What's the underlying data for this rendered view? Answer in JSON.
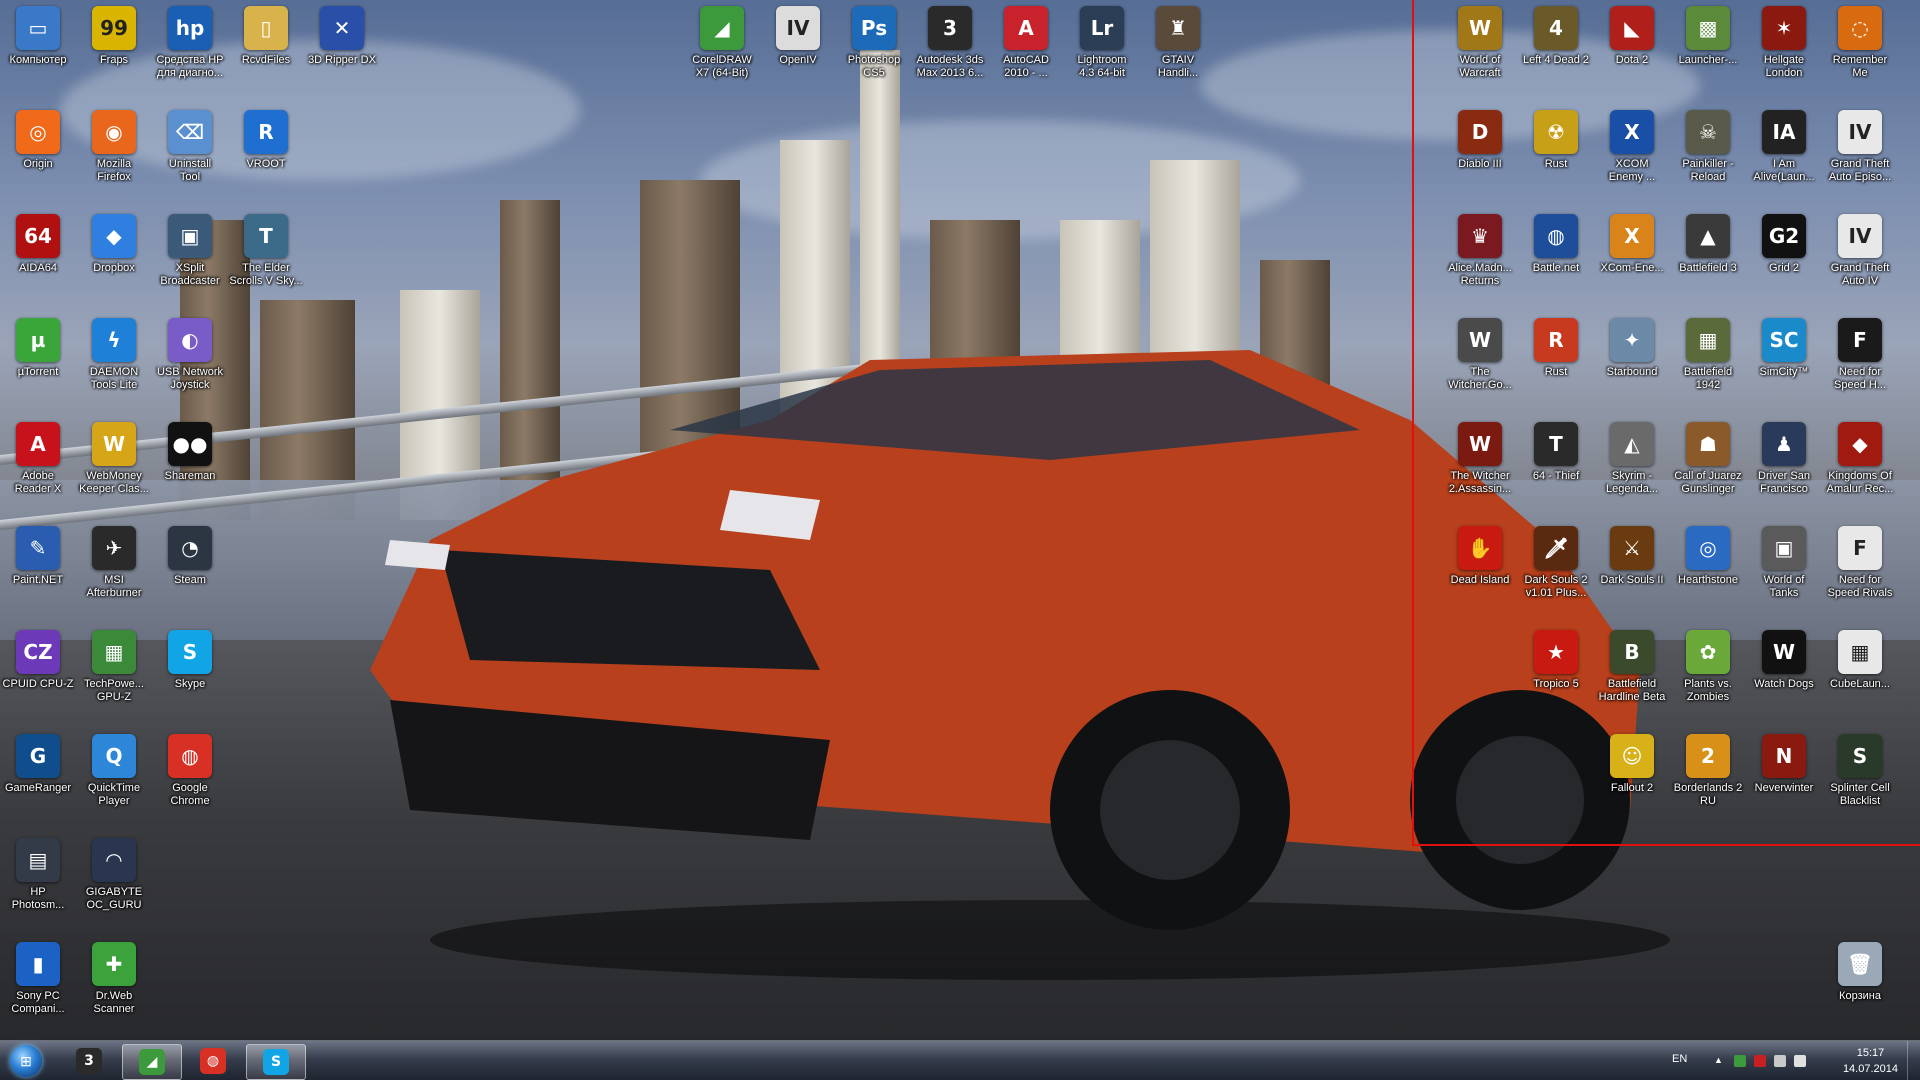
{
  "desktop": {
    "left_icons": [
      {
        "label": "Компьютер",
        "glyph": "▭",
        "color": "#3a78c8"
      },
      {
        "label": "Fraps",
        "glyph": "99",
        "color": "#d9b400"
      },
      {
        "label": "Средства HP\nдля диагно...",
        "glyph": "hp",
        "color": "#1a5fb4"
      },
      {
        "label": "RcvdFiles",
        "glyph": "▯",
        "color": "#d8b24a"
      },
      {
        "label": "3D Ripper DX",
        "glyph": "✕",
        "color": "#2a4fa8"
      },
      {
        "label": "Origin",
        "glyph": "◎",
        "color": "#f06a1a"
      },
      {
        "label": "Mozilla\nFirefox",
        "glyph": "◉",
        "color": "#e8671c"
      },
      {
        "label": "Uninstall\nTool",
        "glyph": "⌫",
        "color": "#5a8fd0"
      },
      {
        "label": "VROOT",
        "glyph": "R",
        "color": "#1e6fd0"
      },
      {
        "label": "AIDA64",
        "glyph": "64",
        "color": "#b01010"
      },
      {
        "label": "Dropbox",
        "glyph": "◆",
        "color": "#2f7fe0"
      },
      {
        "label": "XSplit\nBroadcaster",
        "glyph": "▣",
        "color": "#3b5a7a"
      },
      {
        "label": "The Elder\nScrolls V Sky...",
        "glyph": "T",
        "color": "#3c6b8a"
      },
      {
        "label": "µTorrent",
        "glyph": "µ",
        "color": "#3aa63a"
      },
      {
        "label": "DAEMON\nTools Lite",
        "glyph": "ϟ",
        "color": "#1f80d8"
      },
      {
        "label": "USB Network\nJoystick",
        "glyph": "◐",
        "color": "#7a5cc8"
      },
      {
        "label": "Adobe\nReader X",
        "glyph": "A",
        "color": "#c8121b"
      },
      {
        "label": "WebMoney\nKeeper Clas...",
        "glyph": "W",
        "color": "#d7a518"
      },
      {
        "label": "Shareman",
        "glyph": "●●",
        "color": "#111111"
      },
      {
        "label": "Paint.NET",
        "glyph": "✎",
        "color": "#2a5db0"
      },
      {
        "label": "MSI\nAfterburner",
        "glyph": "✈",
        "color": "#2a2a2a"
      },
      {
        "label": "Steam",
        "glyph": "◔",
        "color": "#2b3642"
      },
      {
        "label": "CPUID CPU-Z",
        "glyph": "CZ",
        "color": "#6c3ab8"
      },
      {
        "label": "TechPowe...\nGPU-Z",
        "glyph": "▦",
        "color": "#3a8a3a"
      },
      {
        "label": "Skype",
        "glyph": "S",
        "color": "#12a5e6"
      },
      {
        "label": "GameRanger",
        "glyph": "G",
        "color": "#0f4d8c"
      },
      {
        "label": "QuickTime\nPlayer",
        "glyph": "Q",
        "color": "#2d86d8"
      },
      {
        "label": "Google\nChrome",
        "glyph": "◍",
        "color": "#d93025"
      },
      {
        "label": "HP\nPhotosm...",
        "glyph": "▤",
        "color": "#333a48"
      },
      {
        "label": "GIGABYTE\nOC_GURU",
        "glyph": "◠",
        "color": "#2a3550"
      },
      {
        "label": "Sony PC\nCompani...",
        "glyph": "▮",
        "color": "#1c62c4"
      },
      {
        "label": "Dr.Web\nScanner",
        "glyph": "✚",
        "color": "#3ca33c"
      }
    ],
    "top_icons": [
      {
        "label": "CorelDRAW\nX7 (64-Bit)",
        "glyph": "◢",
        "color": "#3c9a3c"
      },
      {
        "label": "OpenIV",
        "glyph": "IV",
        "color": "#dcdcdc"
      },
      {
        "label": "Photoshop\nCS5",
        "glyph": "Ps",
        "color": "#1c6ab8"
      },
      {
        "label": "Autodesk 3ds\nMax 2013 6...",
        "glyph": "3",
        "color": "#2a2a2a"
      },
      {
        "label": "AutoCAD\n2010 - ...",
        "glyph": "A",
        "color": "#c8232c"
      },
      {
        "label": "Lightroom\n4.3 64-bit",
        "glyph": "Lr",
        "color": "#2c3e55"
      },
      {
        "label": "GTAIV\nHandli...",
        "glyph": "♜",
        "color": "#5a4a3a"
      }
    ],
    "right_icons": [
      {
        "label": "World of\nWarcraft",
        "glyph": "W",
        "color": "#a07818"
      },
      {
        "label": "Left 4 Dead 2",
        "glyph": "4",
        "color": "#6a5a2a"
      },
      {
        "label": "Dota 2",
        "glyph": "◣",
        "color": "#b0201a"
      },
      {
        "label": "Launcher-...",
        "glyph": "▩",
        "color": "#5a8a3a"
      },
      {
        "label": "Hellgate\nLondon",
        "glyph": "✶",
        "color": "#8a1a10"
      },
      {
        "label": "Remember\nMe",
        "glyph": "◌",
        "color": "#d86a10"
      },
      {
        "label": "Diablo III",
        "glyph": "D",
        "color": "#8a2a10"
      },
      {
        "label": "Rust",
        "glyph": "☢",
        "color": "#c8a018"
      },
      {
        "label": "XCOM\nEnemy ...",
        "glyph": "X",
        "color": "#1a4fa8"
      },
      {
        "label": "Painkiller -\nReload",
        "glyph": "☠",
        "color": "#5a5a4a"
      },
      {
        "label": "I Am\nAlive(Laun...",
        "glyph": "IA",
        "color": "#222222"
      },
      {
        "label": "Grand Theft\nAuto Episo...",
        "glyph": "IV",
        "color": "#e8e8e8"
      },
      {
        "label": "Alice.Madn...\nReturns",
        "glyph": "♛",
        "color": "#7a1a20"
      },
      {
        "label": "Battle.net",
        "glyph": "◍",
        "color": "#1e4e9a"
      },
      {
        "label": "XCom-Ene...",
        "glyph": "X",
        "color": "#d8841a"
      },
      {
        "label": "Battlefield 3",
        "glyph": "▲",
        "color": "#3a3a3a"
      },
      {
        "label": "Grid 2",
        "glyph": "G2",
        "color": "#111111"
      },
      {
        "label": "Grand Theft\nAuto IV",
        "glyph": "IV",
        "color": "#e8e8e8"
      },
      {
        "label": "The\nWitcher.Go...",
        "glyph": "W",
        "color": "#4a4a4a"
      },
      {
        "label": "Rust",
        "glyph": "R",
        "color": "#c83a20"
      },
      {
        "label": "Starbound",
        "glyph": "✦",
        "color": "#6a8aa8"
      },
      {
        "label": "Battlefield\n1942",
        "glyph": "▦",
        "color": "#5a6a3a"
      },
      {
        "label": "SimCity™",
        "glyph": "SC",
        "color": "#1a8acb"
      },
      {
        "label": "Need for\nSpeed H...",
        "glyph": "F",
        "color": "#1a1a1a"
      },
      {
        "label": "The Witcher\n2.Assassin...",
        "glyph": "W",
        "color": "#7a1a10"
      },
      {
        "label": "64 - Thief",
        "glyph": "T",
        "color": "#2a2a2a"
      },
      {
        "label": "Skyrim -\nLegenda...",
        "glyph": "◭",
        "color": "#6a6a6a"
      },
      {
        "label": "Call of Juarez\nGunslinger",
        "glyph": "☗",
        "color": "#8a5a2a"
      },
      {
        "label": "Driver San\nFrancisco",
        "glyph": "♟",
        "color": "#2a3a5a"
      },
      {
        "label": "Kingdoms Of\nAmalur Rec...",
        "glyph": "◆",
        "color": "#a01a10"
      },
      {
        "label": "Dead Island",
        "glyph": "✋",
        "color": "#c81a10"
      },
      {
        "label": "Dark Souls 2\nv1.01 Plus...",
        "glyph": "🗡",
        "color": "#5a2a10"
      },
      {
        "label": "Dark Souls II",
        "glyph": "⚔",
        "color": "#6a3a10"
      },
      {
        "label": "Hearthstone",
        "glyph": "◎",
        "color": "#2a6ac0"
      },
      {
        "label": "World of\nTanks",
        "glyph": "▣",
        "color": "#5a5a5a"
      },
      {
        "label": "Need for\nSpeed Rivals",
        "glyph": "F",
        "color": "#e8e8e8"
      },
      {
        "label": "Tropico 5",
        "glyph": "★",
        "color": "#c81a10"
      },
      {
        "label": "Battlefield\nHardline Beta",
        "glyph": "B",
        "color": "#3a4a2a"
      },
      {
        "label": "Plants vs.\nZombies",
        "glyph": "✿",
        "color": "#6aa83a"
      },
      {
        "label": "Watch Dogs",
        "glyph": "W",
        "color": "#111111"
      },
      {
        "label": "CubeLaun...",
        "glyph": "▦",
        "color": "#e8e8e8"
      },
      {
        "label": "Fallout 2",
        "glyph": "☺",
        "color": "#d8b018"
      },
      {
        "label": "Borderlands 2\nRU",
        "glyph": "2",
        "color": "#d89018"
      },
      {
        "label": "Neverwinter",
        "glyph": "N",
        "color": "#8a1a10"
      },
      {
        "label": "Splinter Cell\nBlacklist",
        "glyph": "S",
        "color": "#2a3a2a"
      },
      {
        "label": "Корзина",
        "glyph": "🗑",
        "color": "#9aa8b8"
      }
    ]
  },
  "taskbar": {
    "start_label": "Start",
    "pinned": [
      {
        "name": "3dsmax-task",
        "glyph": "3",
        "color": "#2a2a2a",
        "active": false
      },
      {
        "name": "corel-task",
        "glyph": "◢",
        "color": "#3c9a3c",
        "active": true
      },
      {
        "name": "chrome-task",
        "glyph": "◍",
        "color": "#d93025",
        "active": false
      },
      {
        "name": "skype-task",
        "glyph": "S",
        "color": "#12a5e6",
        "active": true
      }
    ],
    "tray": {
      "language": "EN",
      "time": "15:17",
      "date": "14.07.2014"
    }
  },
  "colors": {
    "annotation_frame": "#e01010",
    "car": "#c8451e"
  }
}
